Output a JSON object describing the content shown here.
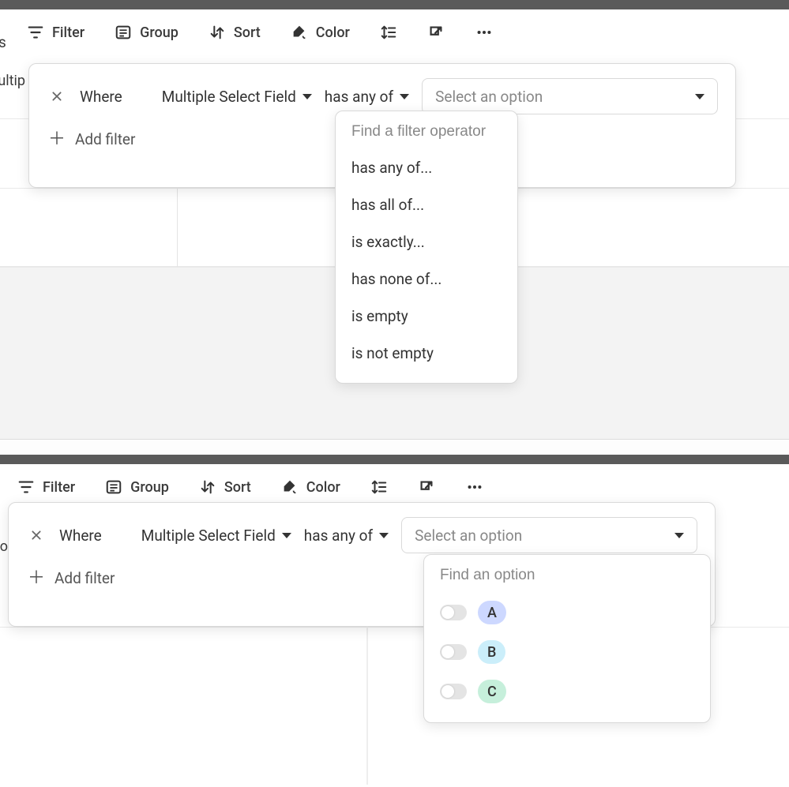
{
  "toolbar": {
    "filter": "Filter",
    "group": "Group",
    "sort": "Sort",
    "color": "Color"
  },
  "filter_row": {
    "where": "Where",
    "field": "Multiple Select Field",
    "operator": "has any of",
    "value_placeholder": "Select an option",
    "add_filter": "Add filter"
  },
  "operator_menu": {
    "search_placeholder": "Find a filter operator",
    "items": [
      "has any of...",
      "has all of...",
      "is exactly...",
      "has none of...",
      "is empty",
      "is not empty"
    ]
  },
  "options_menu": {
    "search_placeholder": "Find an option",
    "items": [
      "A",
      "B",
      "C"
    ]
  },
  "left_cut": {
    "p1": "ultip",
    "p2": "o"
  }
}
